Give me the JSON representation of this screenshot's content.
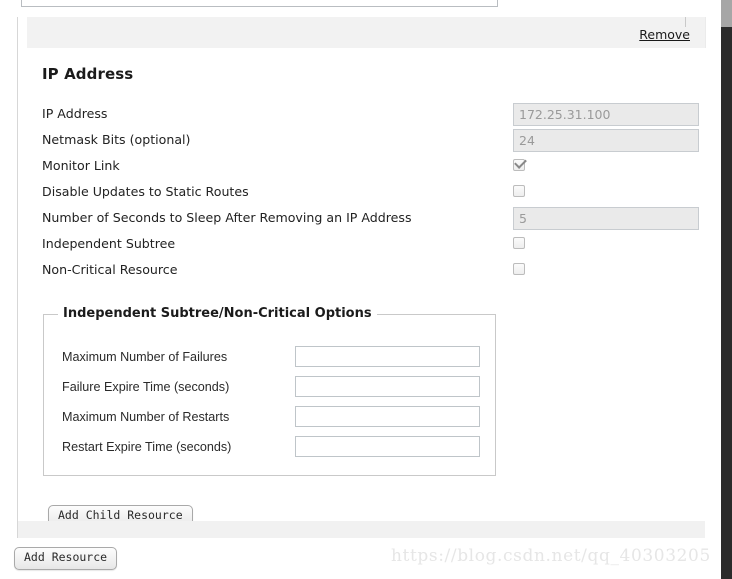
{
  "window": {
    "scrollbar": {
      "name": "vertical-scrollbar",
      "thumb_position": "top"
    }
  },
  "resource_panel": {
    "remove_label": "Remove",
    "section_title": "IP Address",
    "properties": [
      {
        "label": "IP Address",
        "type": "text",
        "value": "172.25.31.100",
        "disabled": true
      },
      {
        "label": "Netmask Bits (optional)",
        "type": "text",
        "value": "24",
        "disabled": true
      },
      {
        "label": "Monitor Link",
        "type": "checkbox",
        "checked": true,
        "disabled": true
      },
      {
        "label": "Disable Updates to Static Routes",
        "type": "checkbox",
        "checked": false,
        "disabled": true
      },
      {
        "label": "Number of Seconds to Sleep After Removing an IP Address",
        "type": "text",
        "value": "5",
        "disabled": true
      },
      {
        "label": "Independent Subtree",
        "type": "checkbox",
        "checked": false,
        "disabled": false
      },
      {
        "label": "Non-Critical Resource",
        "type": "checkbox",
        "checked": false,
        "disabled": false
      }
    ],
    "fieldset": {
      "legend": "Independent Subtree/Non-Critical Options",
      "fields": [
        {
          "label": "Maximum Number of Failures",
          "value": ""
        },
        {
          "label": "Failure Expire Time (seconds)",
          "value": ""
        },
        {
          "label": "Maximum Number of Restarts",
          "value": ""
        },
        {
          "label": "Restart Expire Time (seconds)",
          "value": ""
        }
      ]
    },
    "add_child_resource_label": "Add Child Resource"
  },
  "footer": {
    "add_resource_label": "Add Resource"
  },
  "watermark": {
    "text": "https://blog.csdn.net/qq_40303205"
  },
  "colors": {
    "page_background": "#ffffff",
    "header_strip": "#f2f2f2",
    "disabled_field": "#eaeaea",
    "border": "#c9c9c9",
    "scrollbar_track": "#2b2b2b",
    "scrollbar_thumb": "#a6a6a6",
    "watermark": "#e6e6e6"
  }
}
